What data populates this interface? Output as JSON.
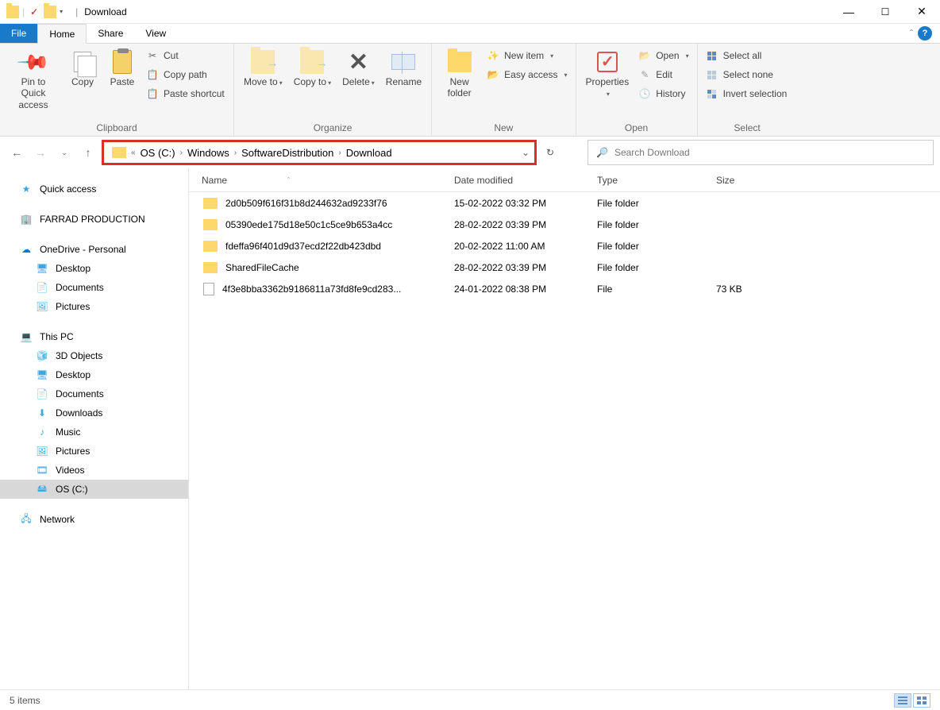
{
  "title": "Download",
  "tabs": {
    "file": "File",
    "home": "Home",
    "share": "Share",
    "view": "View"
  },
  "ribbon": {
    "clipboard": {
      "label": "Clipboard",
      "pin": "Pin to Quick access",
      "copy": "Copy",
      "paste": "Paste",
      "cut": "Cut",
      "copypath": "Copy path",
      "pasteshortcut": "Paste shortcut"
    },
    "organize": {
      "label": "Organize",
      "moveto": "Move to",
      "copyto": "Copy to",
      "delete": "Delete",
      "rename": "Rename"
    },
    "new": {
      "label": "New",
      "newfolder": "New folder",
      "newitem": "New item",
      "easyaccess": "Easy access"
    },
    "open": {
      "label": "Open",
      "properties": "Properties",
      "open": "Open",
      "edit": "Edit",
      "history": "History"
    },
    "select": {
      "label": "Select",
      "all": "Select all",
      "none": "Select none",
      "invert": "Invert selection"
    }
  },
  "breadcrumb": {
    "seg1": "OS (C:)",
    "seg2": "Windows",
    "seg3": "SoftwareDistribution",
    "seg4": "Download"
  },
  "search_placeholder": "Search Download",
  "tree": {
    "quick": "Quick access",
    "farrad": "FARRAD PRODUCTION",
    "onedrive": "OneDrive - Personal",
    "od_desktop": "Desktop",
    "od_docs": "Documents",
    "od_pics": "Pictures",
    "thispc": "This PC",
    "pc_3d": "3D Objects",
    "pc_desktop": "Desktop",
    "pc_docs": "Documents",
    "pc_dl": "Downloads",
    "pc_music": "Music",
    "pc_pics": "Pictures",
    "pc_videos": "Videos",
    "pc_os": "OS (C:)",
    "network": "Network"
  },
  "columns": {
    "name": "Name",
    "date": "Date modified",
    "type": "Type",
    "size": "Size"
  },
  "rows": [
    {
      "name": "2d0b509f616f31b8d244632ad9233f76",
      "date": "15-02-2022 03:32 PM",
      "type": "File folder",
      "size": "",
      "icon": "folder"
    },
    {
      "name": "05390ede175d18e50c1c5ce9b653a4cc",
      "date": "28-02-2022 03:39 PM",
      "type": "File folder",
      "size": "",
      "icon": "folder"
    },
    {
      "name": "fdeffa96f401d9d37ecd2f22db423dbd",
      "date": "20-02-2022 11:00 AM",
      "type": "File folder",
      "size": "",
      "icon": "folder"
    },
    {
      "name": "SharedFileCache",
      "date": "28-02-2022 03:39 PM",
      "type": "File folder",
      "size": "",
      "icon": "folder"
    },
    {
      "name": "4f3e8bba3362b9186811a73fd8fe9cd283...",
      "date": "24-01-2022 08:38 PM",
      "type": "File",
      "size": "73 KB",
      "icon": "file"
    }
  ],
  "status": "5 items"
}
